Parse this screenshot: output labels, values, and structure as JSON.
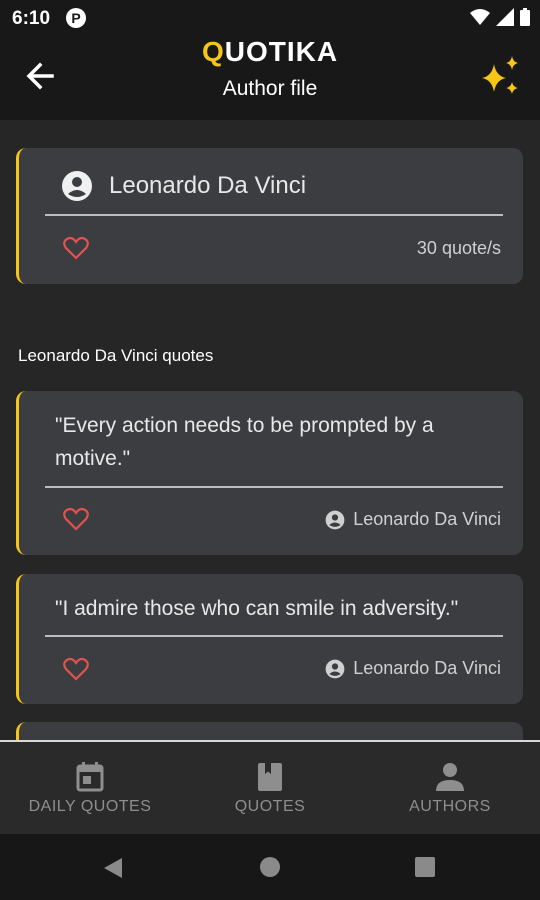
{
  "status_bar": {
    "time": "6:10",
    "app_indicator": "P"
  },
  "app_bar": {
    "title_first_letter": "Q",
    "title_rest": "UOTIKA",
    "subtitle": "Author file",
    "back_icon": "arrow-left-icon",
    "action_icon": "sparkles-icon",
    "accent_color": "#f5c518"
  },
  "author": {
    "name": "Leonardo Da Vinci",
    "quote_count": "30 quote/s"
  },
  "section_title": "Leonardo Da Vinci quotes",
  "quotes": [
    {
      "text": "\"Every action needs to be prompted by a motive.\"",
      "author": "Leonardo Da Vinci"
    },
    {
      "text": "\"I admire those who can smile in adversity.\"",
      "author": "Leonardo Da Vinci"
    }
  ],
  "bottom_nav": [
    {
      "label": "DAILY QUOTES",
      "icon": "calendar-icon"
    },
    {
      "label": "QUOTES",
      "icon": "book-icon"
    },
    {
      "label": "AUTHORS",
      "icon": "person-icon"
    }
  ]
}
